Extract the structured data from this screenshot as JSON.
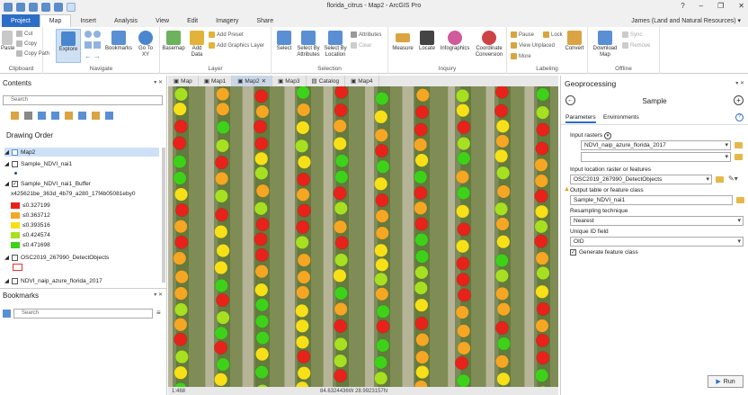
{
  "window": {
    "title": "florida_citrus - Map2 - ArcGIS Pro",
    "controls": [
      "?",
      "–",
      "❐",
      "✕"
    ]
  },
  "user": "James (Land and Natural Resources) ▾",
  "ribbon_tabs": [
    "Project",
    "Map",
    "Insert",
    "Analysis",
    "View",
    "Edit",
    "Imagery",
    "Share"
  ],
  "ribbon": {
    "clipboard": {
      "label": "Clipboard",
      "paste": "Paste",
      "cut": "Cut",
      "copy": "Copy",
      "copy_path": "Copy Path"
    },
    "navigate": {
      "label": "Navigate",
      "explore": "Explore",
      "bookmarks": "Bookmarks",
      "goto": "Go To XY"
    },
    "layer": {
      "label": "Layer",
      "basemap": "Basemap",
      "add_data": "Add Data",
      "add_preset": "Add Preset",
      "add_graphics": "Add Graphics Layer"
    },
    "selection": {
      "label": "Selection",
      "select": "Select",
      "by_attr": "Select By Attributes",
      "by_loc": "Select By Location",
      "attributes": "Attributes",
      "clear": "Clear"
    },
    "inquiry": {
      "label": "Inquiry",
      "measure": "Measure",
      "locate": "Locate",
      "infographics": "Infographics",
      "coord": "Coordinate Conversion"
    },
    "labeling": {
      "label": "Labeling",
      "pause": "Pause",
      "lock": "Lock",
      "view_unplaced": "View Unplaced",
      "more": "More",
      "convert": "Convert"
    },
    "offline": {
      "label": "Offline",
      "download": "Download Map",
      "sync": "Sync",
      "remove": "Remove"
    }
  },
  "contents": {
    "title": "Contents",
    "search_placeholder": "Search",
    "drawing_order": "Drawing Order",
    "items": {
      "map": "Map2",
      "layer1": "Sample_NDVI_nai1",
      "layer2": "Sample_NDVI_nai1_Buffer",
      "field": "x425621be_363d_4b79_a280_17f4b05081eby0",
      "classes": [
        "≤0.327199",
        "≤0.363712",
        "≤0.393516",
        "≤0.424574",
        "≤0.471698"
      ],
      "class_colors": [
        "#e8221a",
        "#f5a623",
        "#f7e017",
        "#a6e021",
        "#3ed11a"
      ],
      "layer3": "OSC2019_267990_DetectObjects",
      "layer4": "NDVI_naip_azure_florida_2017"
    }
  },
  "bookmarks": {
    "title": "Bookmarks",
    "search_placeholder": "Search"
  },
  "map_tabs": [
    "Map",
    "Map1",
    "Map2",
    "Map3",
    "Catalog",
    "Map4"
  ],
  "map_status": {
    "scale": "1:468",
    "coords": "84.6324436W 28.9923157N"
  },
  "gp": {
    "title": "Geoprocessing",
    "tool": "Sample",
    "tabs": [
      "Parameters",
      "Environments"
    ],
    "input_rasters_label": "Input rasters",
    "input_raster_1": "NDVI_naip_azure_florida_2017",
    "input_location_label": "Input location raster or features",
    "input_location": "OSC2019_267990_DetectObjects",
    "output_label": "Output table or feature class",
    "output": "Sample_NDVI_nai1",
    "resampling_label": "Resampling technique",
    "resampling": "Nearest",
    "unique_label": "Unique ID field",
    "unique": "OID",
    "generate_label": "Generate feature class",
    "run": "Run"
  }
}
